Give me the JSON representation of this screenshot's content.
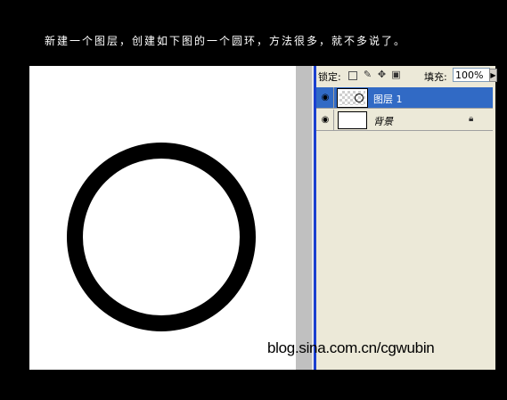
{
  "caption": "新建一个图层，创建如下图的一个圆环，方法很多，就不多说了。",
  "layers_panel": {
    "lock_label": "锁定:",
    "lock_icons": [
      "lock-transparent-icon",
      "lock-paint-icon",
      "lock-move-icon",
      "lock-all-icon"
    ],
    "fill_label": "填充:",
    "fill_value": "100%",
    "layers": [
      {
        "name": "图层 1",
        "selected": true,
        "visible": true,
        "thumbnail": "transparent-ring",
        "locked": false
      },
      {
        "name": "背景",
        "selected": false,
        "visible": true,
        "thumbnail": "white",
        "locked": true
      }
    ]
  },
  "watermark": "blog.sina.com.cn/cgwubin",
  "colors": {
    "background": "#000000",
    "canvas": "#ffffff",
    "ring": "#000000",
    "panel": "#ece9d8",
    "selection": "#316ac5",
    "panel_border": "#1a3fd0"
  }
}
